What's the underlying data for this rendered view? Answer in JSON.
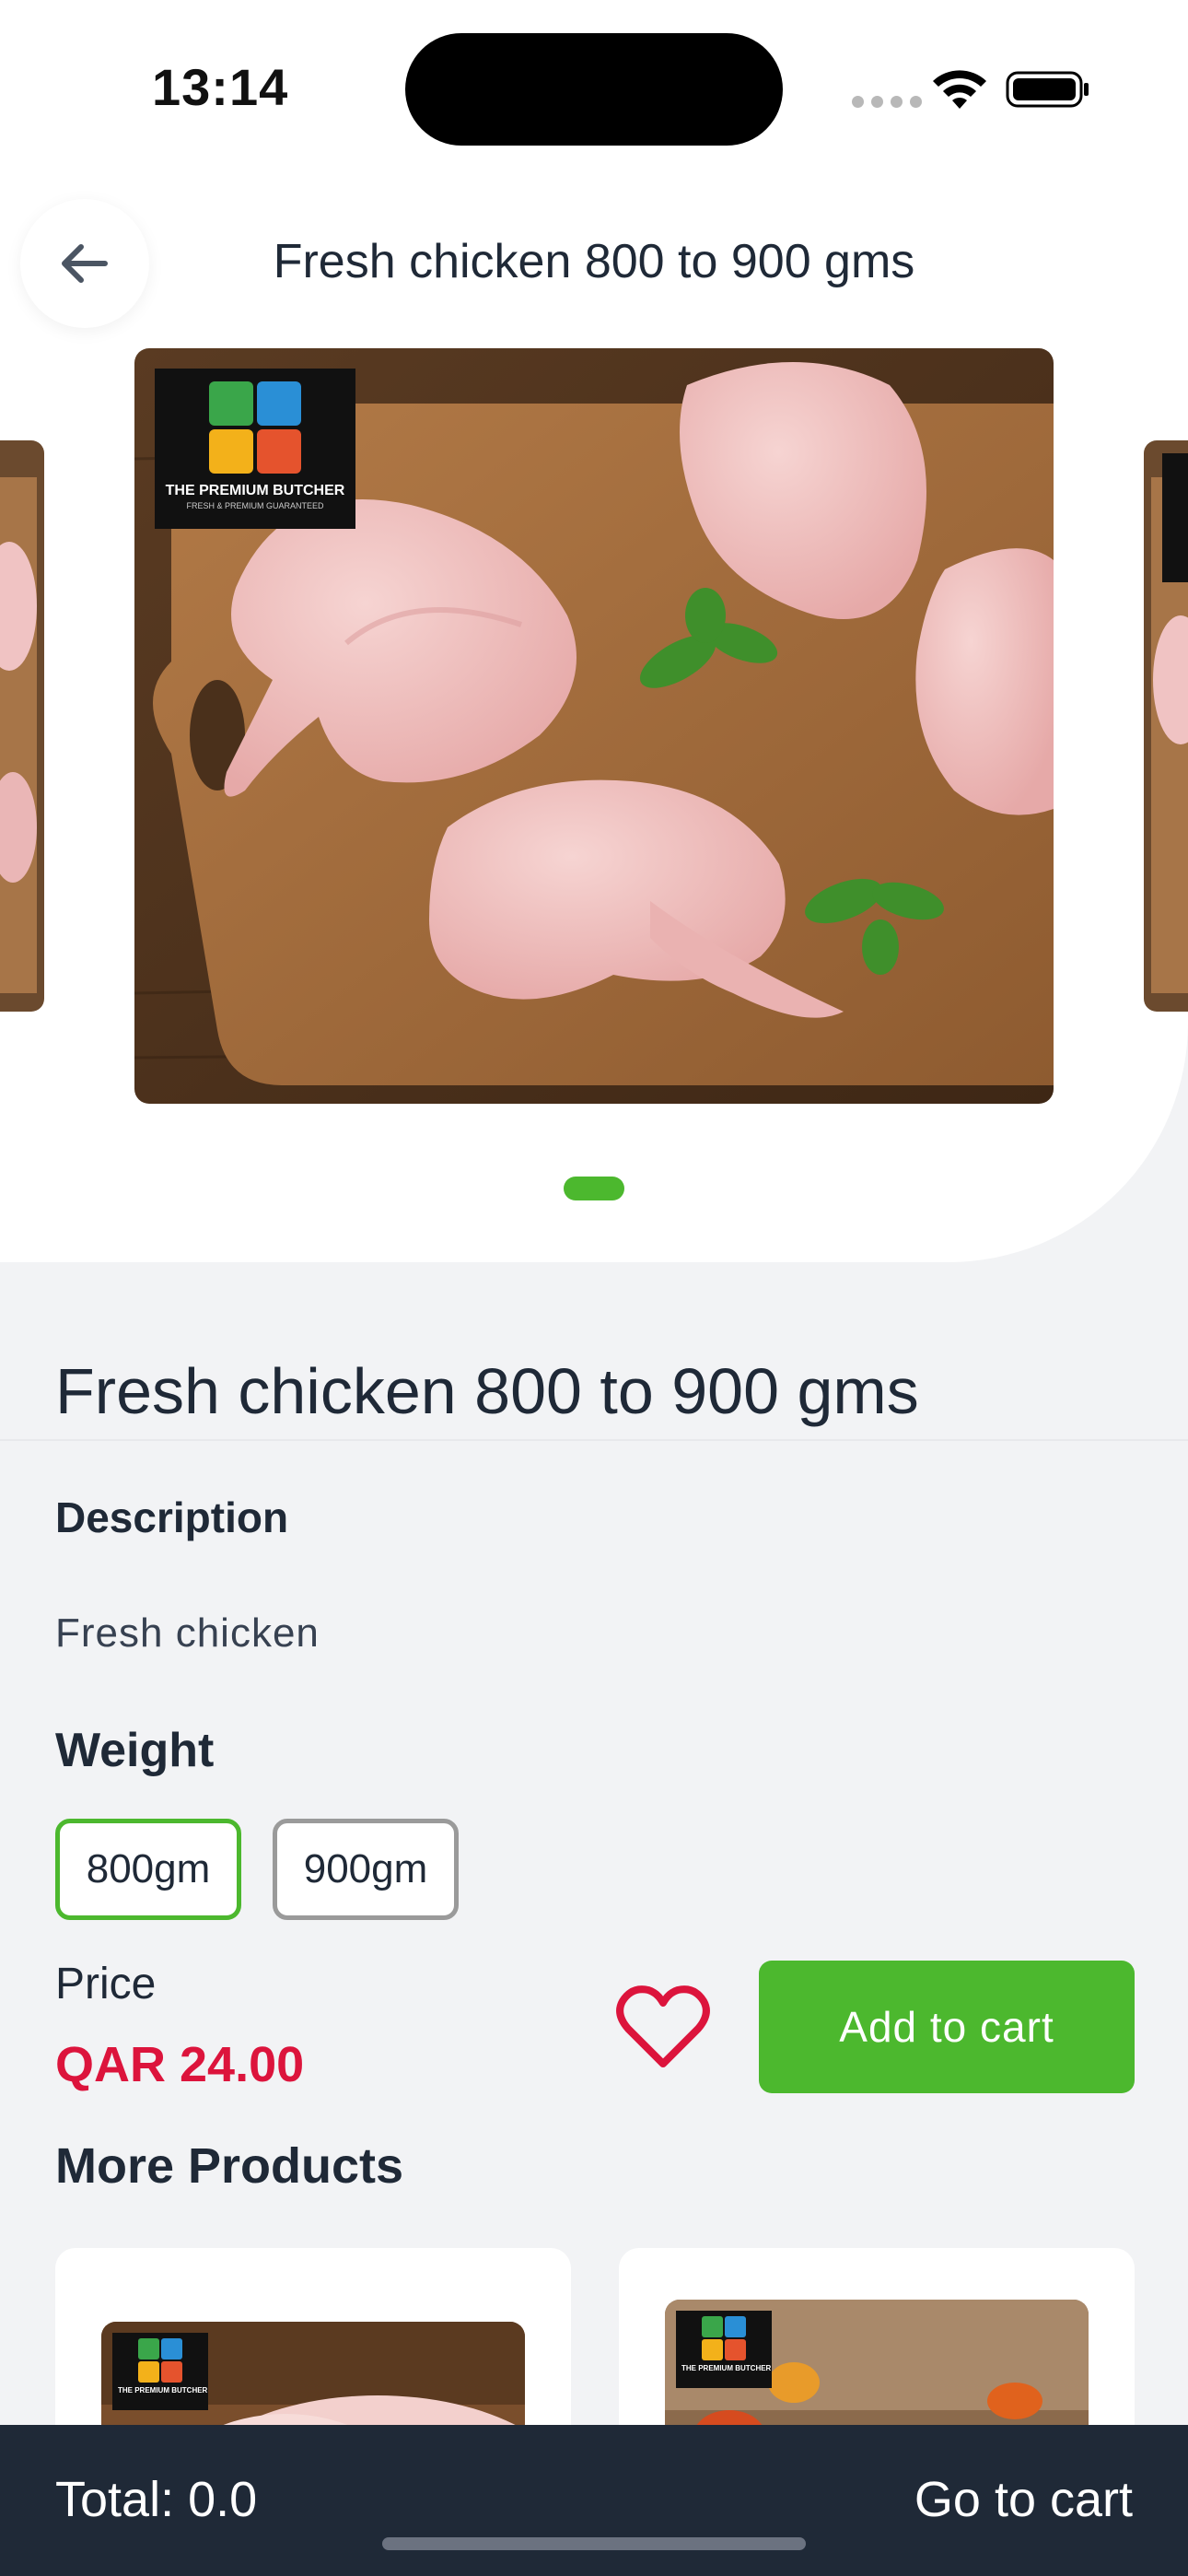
{
  "status_bar": {
    "time": "13:14",
    "icons": [
      "signal-dots-icon",
      "wifi-icon",
      "battery-icon"
    ]
  },
  "header": {
    "back_icon": "arrow-left-icon",
    "title": "Fresh chicken 800 to 900 gms"
  },
  "carousel": {
    "brand_logo_text": "THE PREMIUM BUTCHER",
    "brand_logo_subtext": "FRESH & PREMIUM GUARANTEED",
    "logo_colors": [
      "#3aa64a",
      "#2a8fd6",
      "#f3b11a",
      "#e5532d"
    ],
    "indicator_color": "#4cb82e"
  },
  "product": {
    "title": "Fresh chicken 800 to 900 gms",
    "description_heading": "Description",
    "description": "Fresh chicken",
    "weight_heading": "Weight",
    "weights": [
      {
        "label": "800gm",
        "selected": true
      },
      {
        "label": "900gm",
        "selected": false
      }
    ],
    "price_label": "Price",
    "price": "QAR 24.00",
    "favorite_icon": "heart-outline-icon",
    "add_to_cart_label": "Add to cart"
  },
  "more_products": {
    "heading": "More Products",
    "cards": [
      {
        "logo_text": "THE PREMIUM BUTCHER"
      },
      {
        "logo_text": "THE PREMIUM BUTCHER"
      }
    ]
  },
  "bottom_bar": {
    "total": "Total: 0.0",
    "go_to_cart": "Go to cart"
  },
  "colors": {
    "accent_green": "#4cb82e",
    "price_red": "#dc143c",
    "bottom_bar": "#1f2937"
  }
}
